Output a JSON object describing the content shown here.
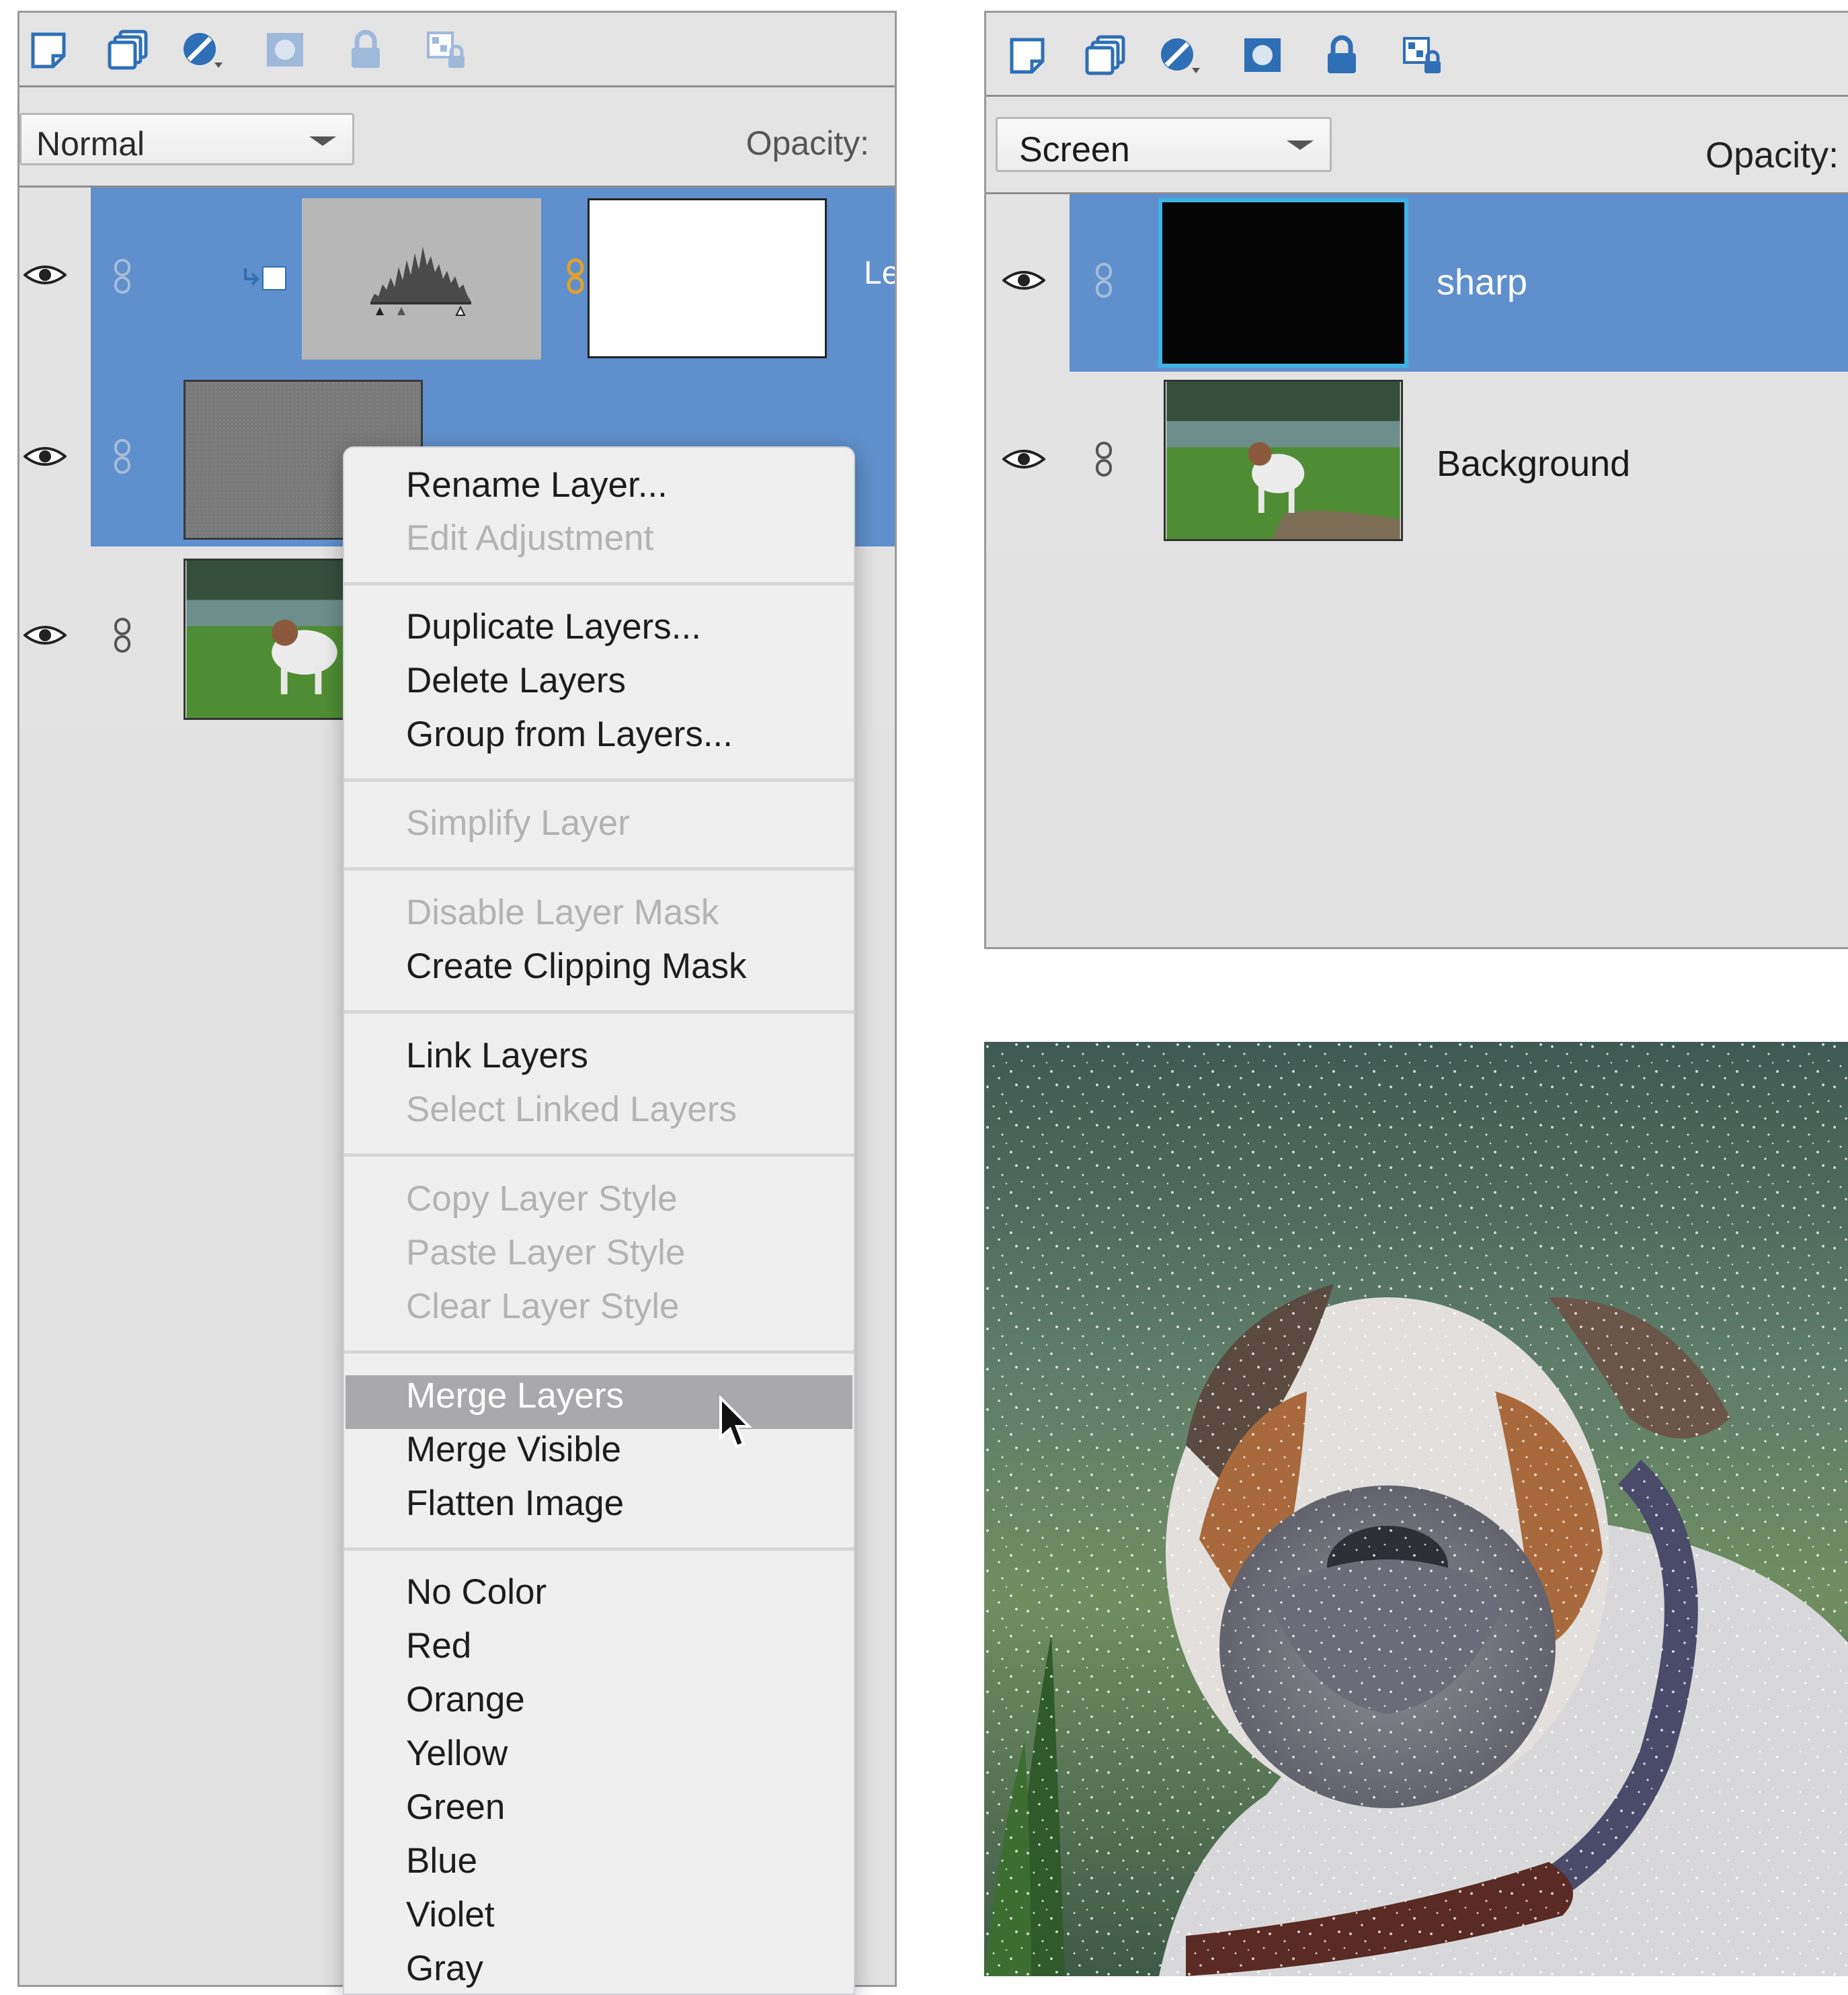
{
  "left_panel": {
    "toolbar_icons": [
      "new-layer-icon",
      "duplicate-layer-icon",
      "adjustment-layer-icon",
      "mask-icon",
      "lock-icon",
      "lock-transparency-icon"
    ],
    "blend_mode": "Normal",
    "opacity_label": "Opacity:",
    "layers": [
      {
        "name_partial": "Le",
        "kind": "levels-adjustment",
        "selected": true
      },
      {
        "name_partial": "",
        "kind": "noise-gray",
        "selected": true
      },
      {
        "name_partial": "",
        "kind": "photo",
        "selected": false
      }
    ]
  },
  "context_menu": {
    "groups": [
      [
        {
          "label": "Rename Layer...",
          "enabled": true
        },
        {
          "label": "Edit Adjustment",
          "enabled": false
        }
      ],
      [
        {
          "label": "Duplicate Layers...",
          "enabled": true
        },
        {
          "label": "Delete Layers",
          "enabled": true
        },
        {
          "label": "Group from Layers...",
          "enabled": true
        }
      ],
      [
        {
          "label": "Simplify Layer",
          "enabled": false
        }
      ],
      [
        {
          "label": "Disable Layer Mask",
          "enabled": false
        },
        {
          "label": "Create Clipping Mask",
          "enabled": true
        }
      ],
      [
        {
          "label": "Link Layers",
          "enabled": true
        },
        {
          "label": "Select Linked Layers",
          "enabled": false
        }
      ],
      [
        {
          "label": "Copy Layer Style",
          "enabled": false
        },
        {
          "label": "Paste Layer Style",
          "enabled": false
        },
        {
          "label": "Clear Layer Style",
          "enabled": false
        }
      ],
      [
        {
          "label": "Merge Layers",
          "enabled": true,
          "highlighted": true
        },
        {
          "label": "Merge Visible",
          "enabled": true
        },
        {
          "label": "Flatten Image",
          "enabled": true
        }
      ],
      [
        {
          "label": "No Color",
          "enabled": true
        },
        {
          "label": "Red",
          "enabled": true
        },
        {
          "label": "Orange",
          "enabled": true
        },
        {
          "label": "Yellow",
          "enabled": true
        },
        {
          "label": "Green",
          "enabled": true
        },
        {
          "label": "Blue",
          "enabled": true
        },
        {
          "label": "Violet",
          "enabled": true
        },
        {
          "label": "Gray",
          "enabled": true
        }
      ]
    ]
  },
  "right_panel": {
    "blend_mode": "Screen",
    "opacity_label": "Opacity:",
    "layers": [
      {
        "name": "sharp",
        "selected": true
      },
      {
        "name": "Background",
        "selected": false
      }
    ]
  },
  "colors": {
    "selection_blue": "#5f8fcc",
    "panel_gray": "#e3e3e3",
    "menu_bg": "#efeff0",
    "menu_highlight": "#a9a9ab",
    "icon_blue": "#2f6fb5",
    "link_gold": "#e0a12c"
  }
}
